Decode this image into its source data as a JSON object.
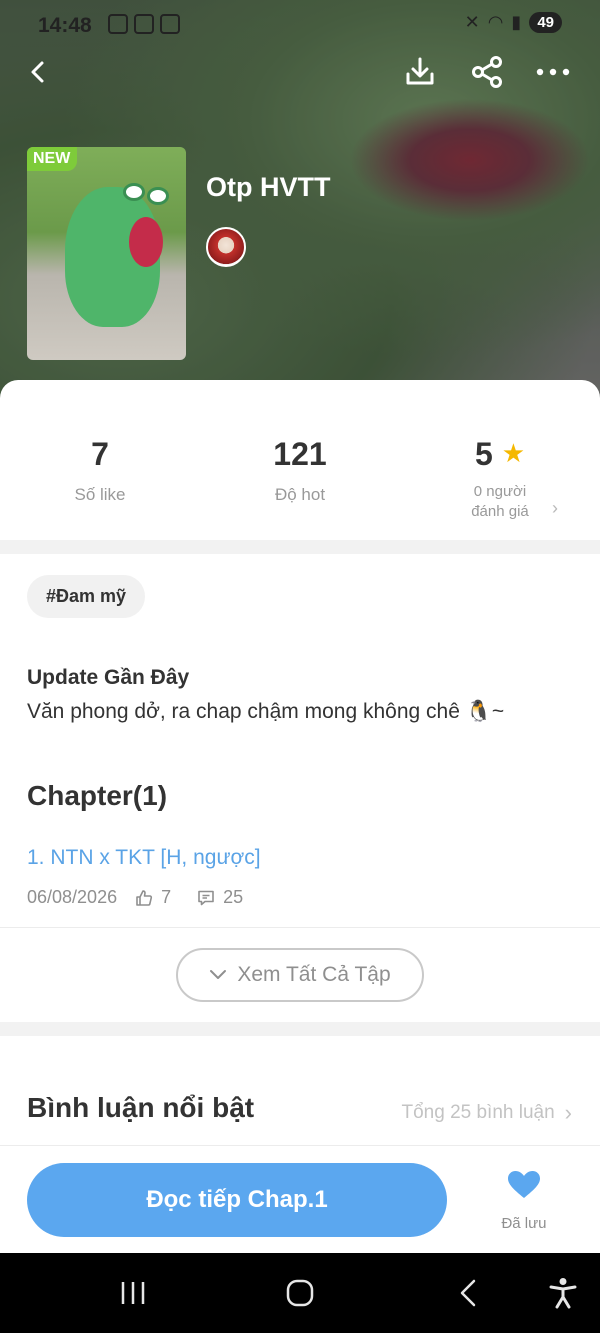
{
  "status_bar": {
    "time": "14:48",
    "battery": "49"
  },
  "book": {
    "badge": "NEW",
    "title": "Otp HVTT"
  },
  "stats": {
    "likes": {
      "value": "7",
      "label": "Số like"
    },
    "hot": {
      "value": "121",
      "label": "Độ hot"
    },
    "rating": {
      "value": "5",
      "label_line1": "0 người",
      "label_line2": "đánh giá"
    }
  },
  "tags": [
    "#Đam mỹ"
  ],
  "update": {
    "heading": "Update Gần Đây",
    "text": "Văn phong dở, ra chap chậm mong không chê 🐧~"
  },
  "chapters": {
    "heading": "Chapter(1)",
    "items": [
      {
        "title": "1. NTN x TKT [H, ngược]",
        "date": "06/08/2026",
        "likes": "7",
        "comments": "25"
      }
    ],
    "view_all_label": "Xem Tất Cả Tập"
  },
  "comments": {
    "heading": "Bình luận nổi bật",
    "total": "Tổng 25 bình luận"
  },
  "actions": {
    "read_label": "Đọc tiếp Chap.1",
    "saved_label": "Đã lưu"
  },
  "colors": {
    "accent": "#5ba7ef",
    "link": "#5aa3e6",
    "star": "#f5b800",
    "new_badge": "#7ecb3a"
  }
}
